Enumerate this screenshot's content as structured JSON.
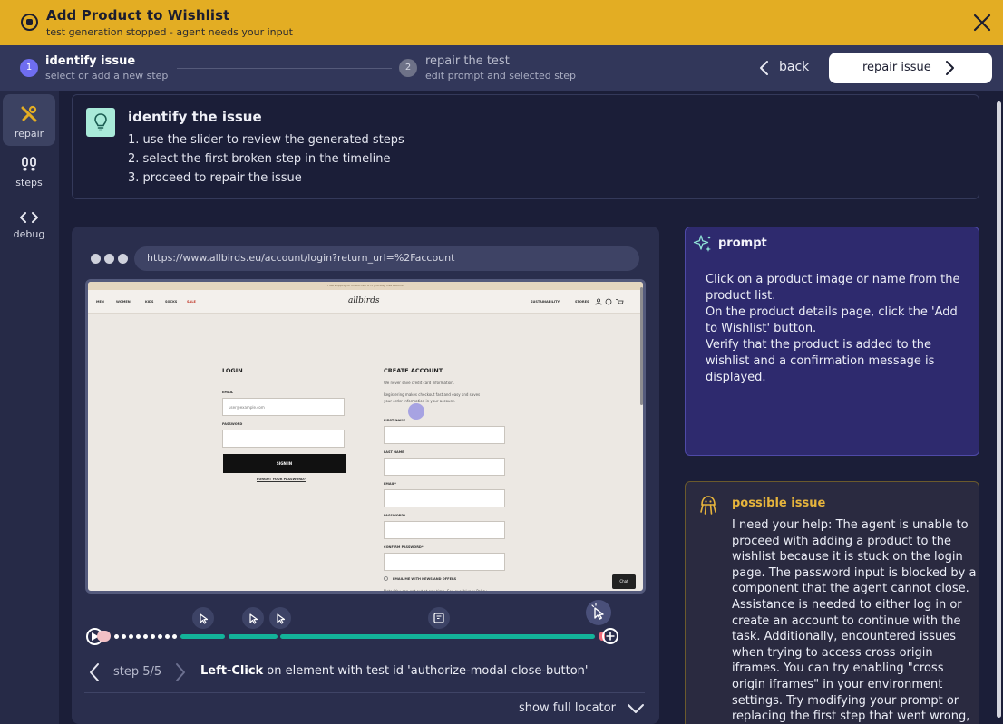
{
  "header": {
    "title": "Add Product to Wishlist",
    "subtitle": "test generation stopped - agent needs your input"
  },
  "stepper": {
    "steps": [
      {
        "number": "1",
        "title": "identify issue",
        "subtitle": "select or add a new step"
      },
      {
        "number": "2",
        "title": "repair the test",
        "subtitle": "edit prompt and selected step"
      }
    ],
    "back_label": "back",
    "repair_label": "repair issue"
  },
  "sidebar": {
    "items": [
      {
        "label": "repair",
        "icon": "tools-icon"
      },
      {
        "label": "steps",
        "icon": "footsteps-icon"
      },
      {
        "label": "debug",
        "icon": "code-icon"
      }
    ]
  },
  "identify": {
    "title": "identify the issue",
    "items": [
      "1. use the slider to review the generated steps",
      "2. select the first broken step in the timeline",
      "3. proceed to repair the issue"
    ]
  },
  "browser": {
    "url": "https://www.allbirds.eu/account/login?return_url=%2Faccount"
  },
  "site": {
    "banner": "Free shipping on orders over €75 | 30-Day Free Returns",
    "nav_left": [
      "MEN",
      "WOMEN",
      "KIDS",
      "SOCKS",
      "SALE"
    ],
    "logo": "allbirds",
    "nav_right": [
      "SUSTAINABILITY",
      "STORES"
    ],
    "login_heading": "LOGIN",
    "email_label": "EMAIL",
    "email_value": "user@example.com",
    "password_label": "PASSWORD",
    "signin_label": "SIGN IN",
    "forgot_label": "FORGOT YOUR PASSWORD?",
    "create_heading": "CREATE ACCOUNT",
    "create_line1": "We never save credit card information.",
    "create_line2": "Registering makes checkout fast and easy and saves",
    "create_line3": "your order information in your account.",
    "first_name_label": "FIRST NAME",
    "last_name_label": "LAST NAME",
    "email2_label": "EMAIL*",
    "password2_label": "PASSWORD*",
    "confirm_label": "CONFIRM PASSWORD*",
    "news_label": "EMAIL ME WITH NEWS AND OFFERS",
    "note": "Note: You can opt out at any time. See our Privacy Policy",
    "chat_label": "Chat"
  },
  "timeline": {
    "current_step": 5,
    "total_steps": 5,
    "step_label": "step 5/5"
  },
  "step_detail": {
    "action": "Left-Click",
    "description": " on element with test id 'authorize-modal-close-button'",
    "show_locator_label": "show full locator"
  },
  "prompt": {
    "title": "prompt",
    "lines": [
      "Click on a product image or name from the",
      "product list.",
      "On the product details page, click the 'Add",
      "to Wishlist' button.",
      "Verify that the product is added to the",
      "wishlist and a confirmation message is",
      "displayed."
    ]
  },
  "issue": {
    "title": "possible issue",
    "lines": [
      "I need your help: The agent is unable to",
      "proceed with adding a product to the",
      "wishlist because it is stuck on the login",
      "page. The password input is blocked by a",
      "component that the agent cannot close.",
      "Assistance is needed to either log in or",
      "create an account to continue with the",
      "task. Additionally, encountered issues",
      "when trying to access cross origin",
      "iframes. You can try enabling \"cross",
      "origin iframes\" in your environment",
      "settings. Try modifying your prompt or",
      "replacing the first step that went wrong,"
    ]
  },
  "colors": {
    "accent": "#e3ad23",
    "background": "#1b1e38",
    "timeline": "#13b39a",
    "prompt_card": "#2e2a6e",
    "issue_title": "#e6b43c",
    "step_active": "#6f6df0"
  }
}
